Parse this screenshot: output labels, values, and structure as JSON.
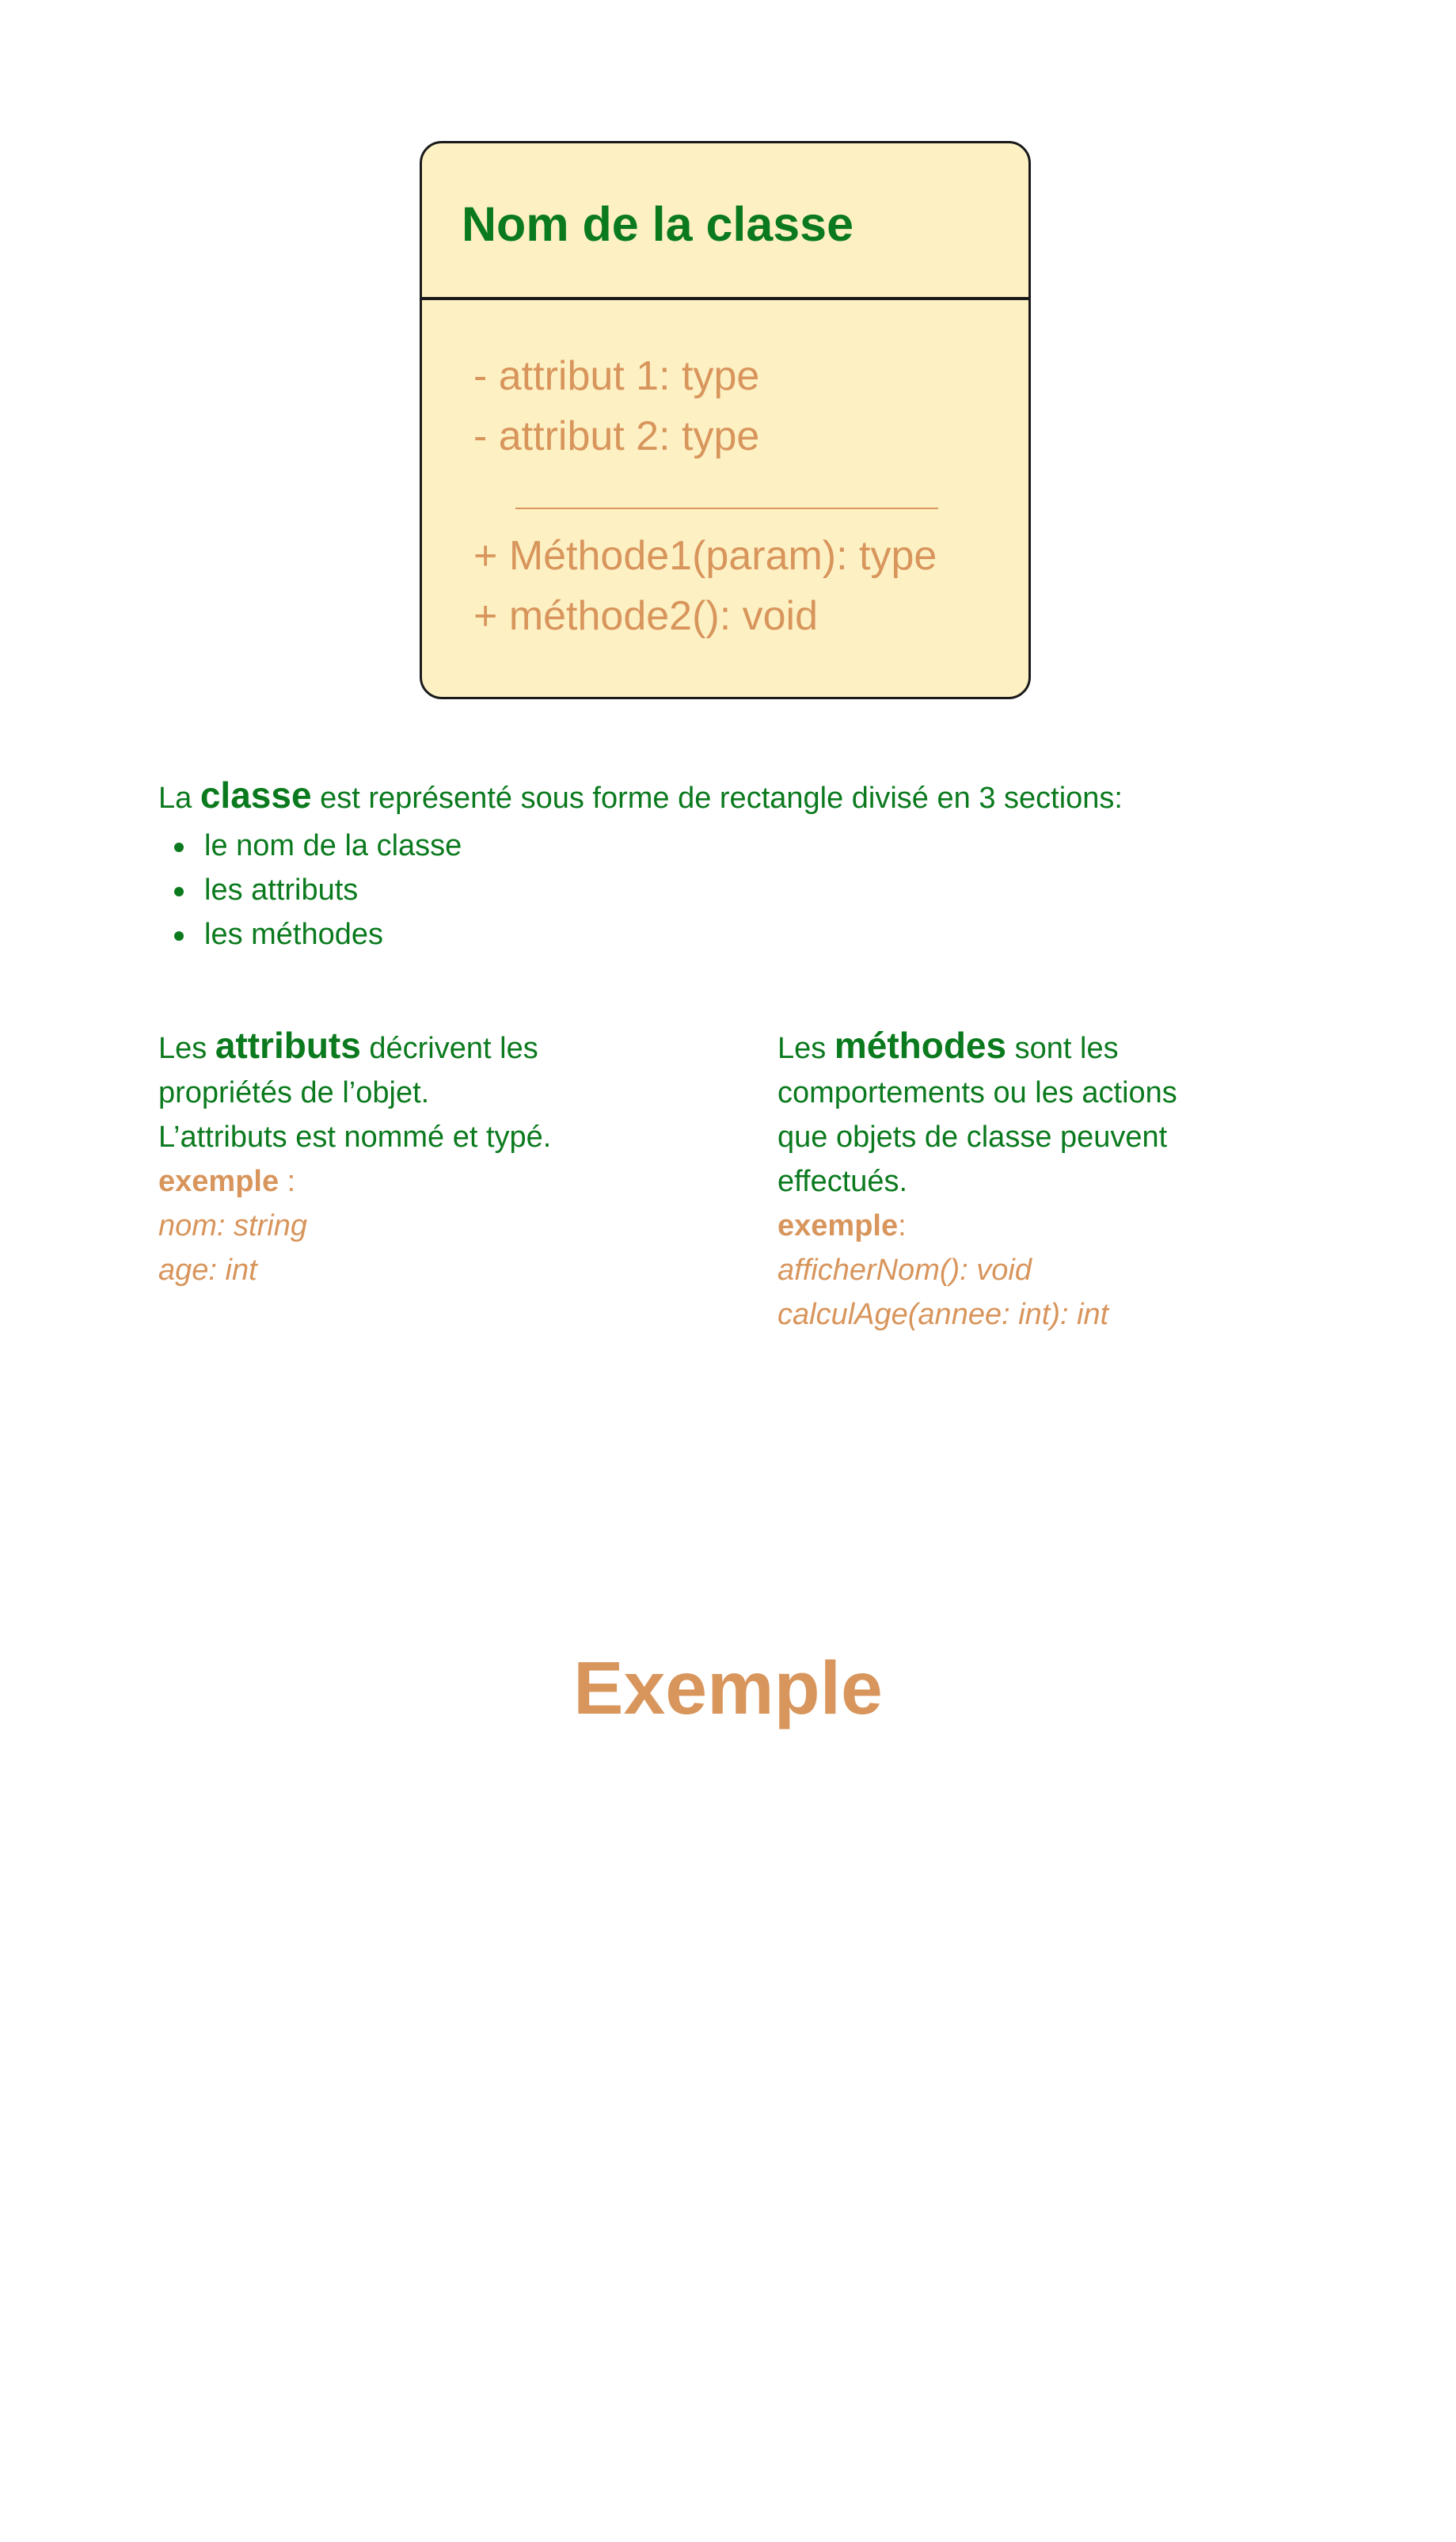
{
  "uml": {
    "class_name": "Nom de la classe",
    "attributes": [
      "- attribut 1: type",
      "- attribut 2: type"
    ],
    "methods": [
      "+ Méthode1(param): type",
      "+ méthode2(): void"
    ]
  },
  "intro": {
    "prefix": "La ",
    "keyword": "classe",
    "suffix": " est représenté sous forme de rectangle divisé en 3 sections:",
    "bullets": [
      "le nom de la classe",
      "les attributs",
      "les méthodes"
    ]
  },
  "attributes_block": {
    "prefix": "Les ",
    "keyword": "attributs",
    "line1_suffix": " décrivent les",
    "line2": "propriétés de l’objet.",
    "line3": "L’attributs est nommé et typé.",
    "example_label": "exemple",
    "example_colon": " :",
    "examples": [
      "nom: string",
      "age: int"
    ]
  },
  "methods_block": {
    "prefix": "Les ",
    "keyword": "méthodes",
    "line1_suffix": " sont les",
    "line2": "comportements ou les actions",
    "line3": "que objets de classe peuvent",
    "line4": "effectués.",
    "example_label": "exemple",
    "example_colon": ":",
    "examples": [
      "afficherNom(): void",
      "calculAge(annee: int): int"
    ]
  },
  "section_title": "Exemple",
  "colors": {
    "green": "#0b7a1e",
    "tan": "#d8955c",
    "box_fill": "#fdf1c4",
    "border": "#1a1a1a"
  }
}
